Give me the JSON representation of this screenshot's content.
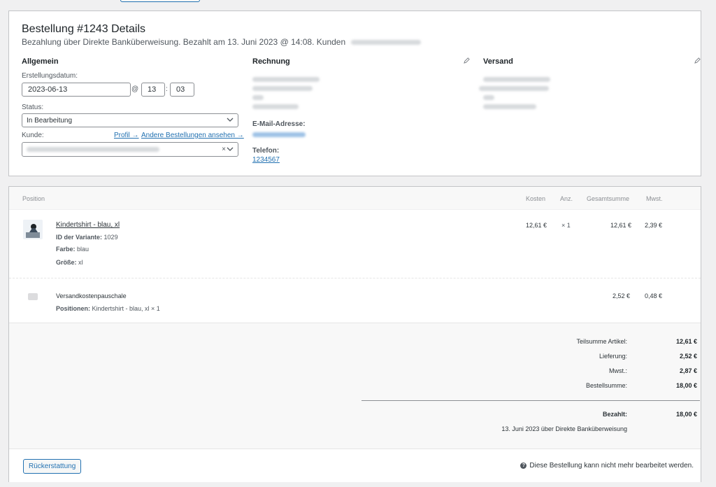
{
  "order": {
    "title": "Bestellung #1243 Details",
    "subtitle": "Bezahlung über Direkte Banküberweisung. Bezahlt am 13. Juni 2023 @ 14:08. Kunden",
    "general": {
      "heading": "Allgemein",
      "created_label": "Erstellungsdatum:",
      "date": "2023-06-13",
      "at": "@",
      "hour": "13",
      "colon": ":",
      "minute": "03",
      "status_label": "Status:",
      "status_value": "In Bearbeitung",
      "customer_label": "Kunde:",
      "profile_link": "Profil →",
      "other_orders_link": "Andere Bestellungen ansehen →",
      "clear_symbol": "×"
    },
    "billing": {
      "heading": "Rechnung",
      "email_label": "E-Mail-Adresse:",
      "phone_label": "Telefon:",
      "phone": "1234567"
    },
    "shipping": {
      "heading": "Versand"
    }
  },
  "items": {
    "columns": {
      "position": "Position",
      "cost": "Kosten",
      "qty": "Anz.",
      "total": "Gesamtsumme",
      "tax": "Mwst."
    },
    "product": {
      "name": "Kindertshirt - blau, xl",
      "variant_label": "ID der Variante:",
      "variant_id": "1029",
      "color_label": "Farbe:",
      "color_value": "blau",
      "size_label": "Größe:",
      "size_value": "xl",
      "cost": "12,61 €",
      "qty": "× 1",
      "total": "12,61 €",
      "tax": "2,39 €"
    },
    "shipping_line": {
      "name": "Versandkostenpauschale",
      "positions_label": "Positionen:",
      "positions_value": "Kindertshirt - blau, xl × 1",
      "total": "2,52 €",
      "tax": "0,48 €"
    }
  },
  "totals": {
    "subtotal_label": "Teilsumme Artikel:",
    "subtotal": "12,61 €",
    "shipping_label": "Lieferung:",
    "shipping": "2,52 €",
    "tax_label": "Mwst.:",
    "tax": "2,87 €",
    "order_total_label": "Bestellsumme:",
    "order_total": "18,00 €",
    "paid_label": "Bezahlt:",
    "paid": "18,00 €",
    "paid_note": "13. Juni 2023 über Direkte Banküberweisung"
  },
  "footer": {
    "refund_button": "Rückerstattung",
    "help_symbol": "?",
    "locked_note": "Diese Bestellung kann nicht mehr bearbeitet werden."
  },
  "colors": {
    "link": "#2271b1",
    "border": "#c3c4c7",
    "background": "#f0f0f1"
  }
}
